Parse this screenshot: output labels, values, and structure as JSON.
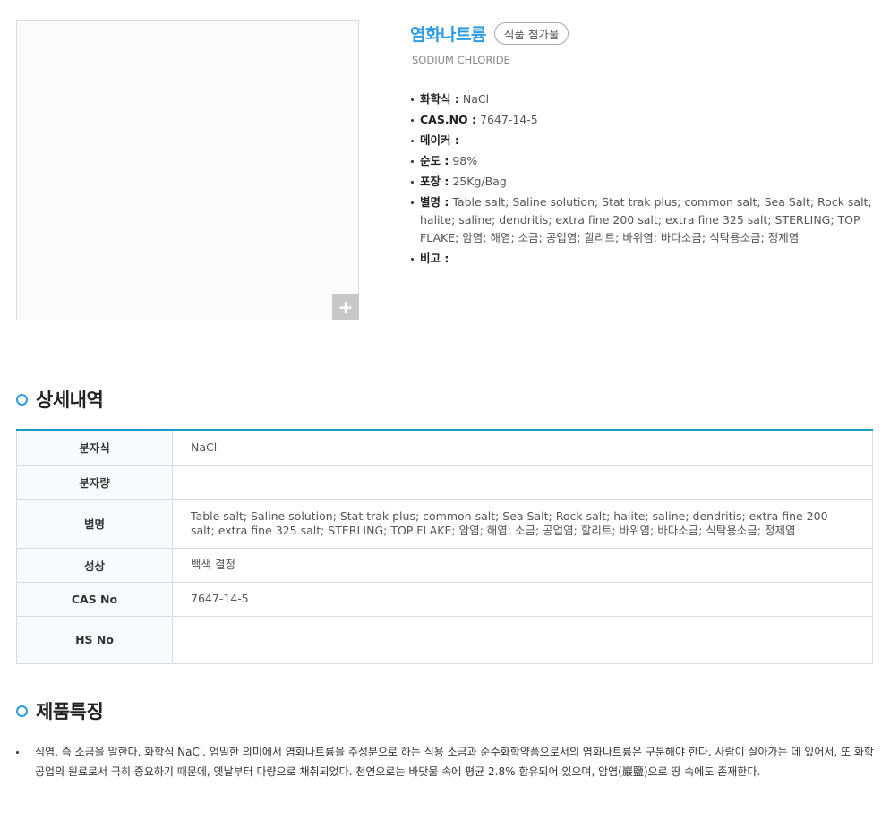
{
  "product": {
    "title": "염화나트륨",
    "badge": "식품 첨가물",
    "subtitle": "SODIUM CHLORIDE",
    "zoom_label": "+",
    "specs": [
      {
        "key": "화학식 :",
        "value": "NaCl"
      },
      {
        "key": "CAS.NO :",
        "value": "7647-14-5"
      },
      {
        "key": "메이커 :",
        "value": ""
      },
      {
        "key": "순도 :",
        "value": "98%"
      },
      {
        "key": "포장 :",
        "value": "25Kg/Bag"
      },
      {
        "key": "별명 :",
        "value": "Table salt; Saline solution; Stat trak plus; common salt; Sea Salt; Rock salt; halite; saline; dendritis; extra fine 200 salt; extra fine 325 salt; STERLING; TOP FLAKE; 암염; 해염; 소금; 공업염; 할리트; 바위염; 바다소금; 식탁용소금; 정제염"
      },
      {
        "key": "비고 :",
        "value": ""
      }
    ]
  },
  "details": {
    "heading": "상세내역",
    "rows": [
      {
        "label": "분자식",
        "value": "NaCl"
      },
      {
        "label": "분자량",
        "value": ""
      },
      {
        "label": "별명",
        "value": "Table salt; Saline solution; Stat trak plus; common salt; Sea Salt; Rock salt; halite; saline; dendritis; extra fine 200 salt; extra fine 325 salt; STERLING; TOP FLAKE; 암염; 해염; 소금; 공업염; 할리트; 바위염; 바다소금; 식탁용소금; 정제염"
      },
      {
        "label": "성상",
        "value": "백색 결정"
      },
      {
        "label": "CAS No",
        "value": "7647-14-5"
      },
      {
        "label": "HS No",
        "value": ""
      }
    ]
  },
  "features": {
    "heading": "제품특징",
    "items": [
      "식염, 즉 소금을 말한다. 화학식 NaCl. 엄밀한 의미에서 염화나트륨을 주성분으로 하는 식용 소금과 순수화학약품으로서의 염화나트륨은 구분해야 한다. 사람이 살아가는 데 있어서, 또 화학공업의 원료로서 극히 중요하기 때문에, 옛날부터 다량으로 채취되었다. 천연으로는 바닷물 속에 평균 2.8% 함유되어 있으며, 암염(巖鹽)으로 땅 속에도 존재한다."
    ]
  },
  "colors": {
    "accent": "#2f9be0",
    "table_border_top": "#1a9ac9"
  }
}
